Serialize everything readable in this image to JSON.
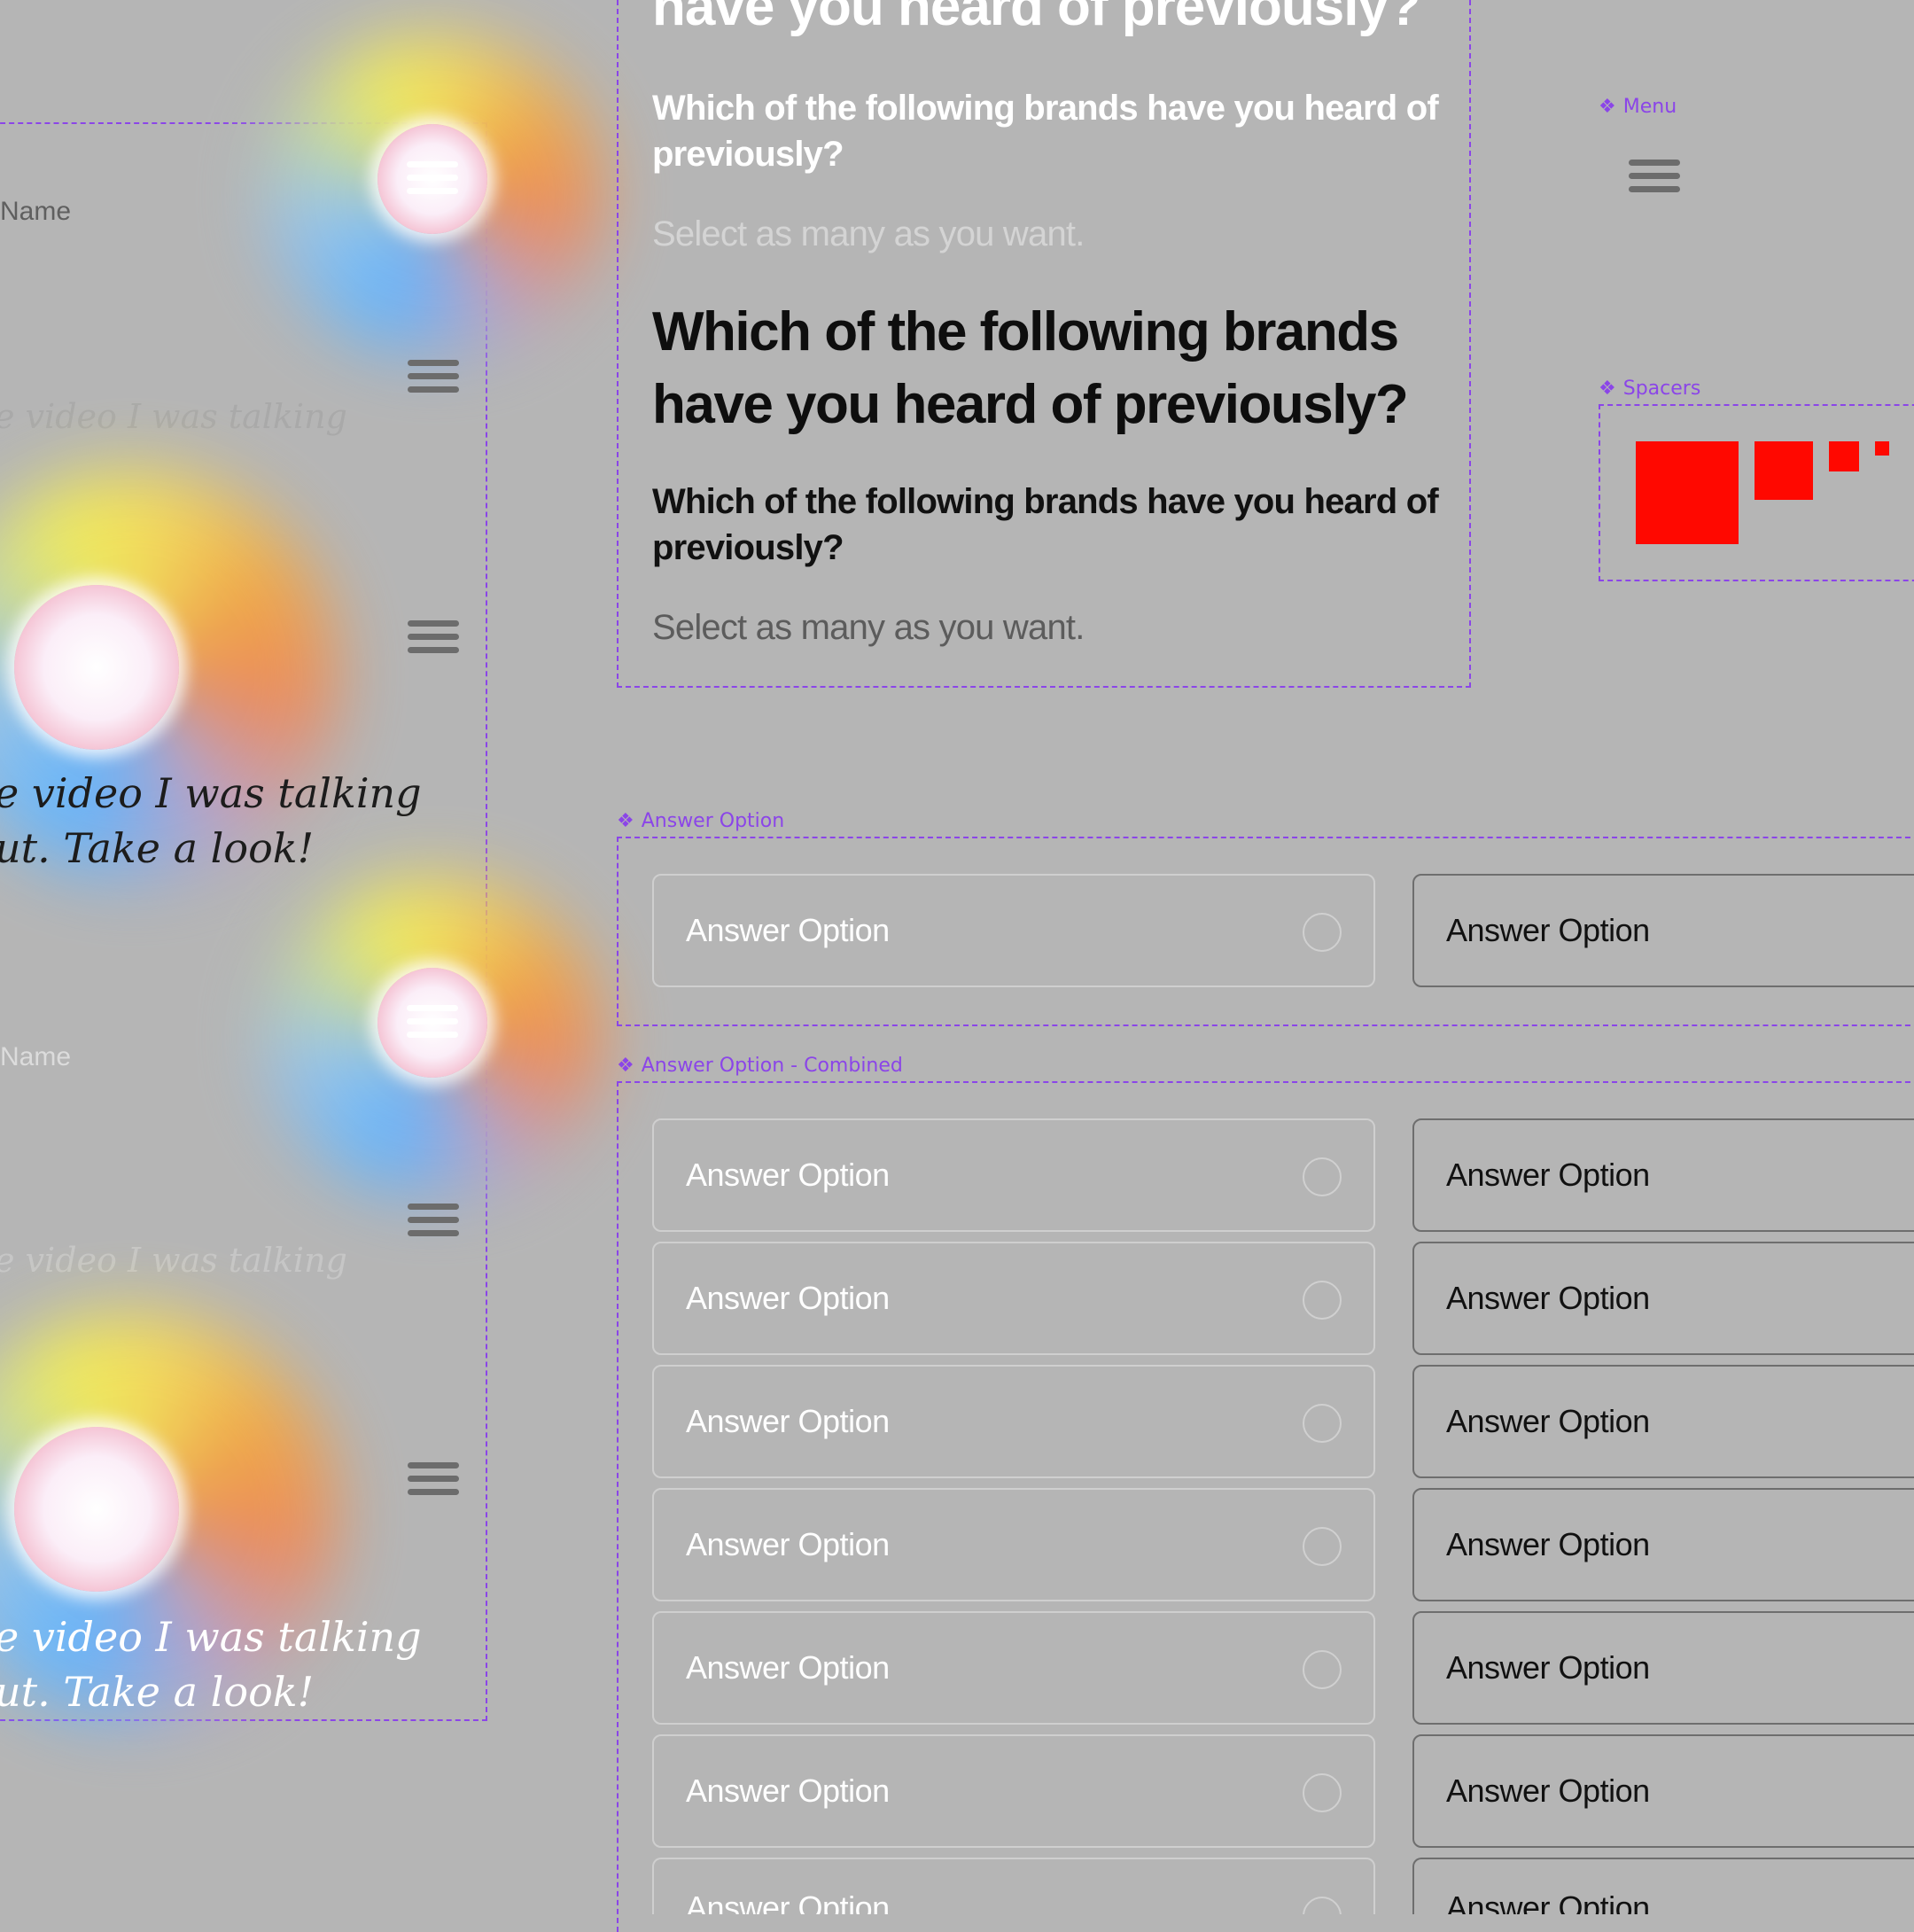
{
  "left_panel": {
    "name_label_1": "Name",
    "name_label_2": "Name",
    "faded_quote_1": "e video I was talking",
    "faded_quote_2": "e video I was talking",
    "quote_dark": {
      "line1": "e video I was talking",
      "line2": "ut. Take a look!"
    },
    "quote_light": {
      "line1": "e video I was talking",
      "line2": "ut. Take a look!"
    }
  },
  "typography_panel": {
    "top_heading": "have you heard of previously?",
    "question_light": "Which of the following brands have you heard of previously?",
    "helper_light": "Select as many as you want.",
    "question_large": "Which of the following brands have you heard of previously?",
    "question_dark": "Which of the following brands have you heard of previously?",
    "helper_dark": "Select as many as you want."
  },
  "components": {
    "menu_label": "Menu",
    "spacers_label": "Spacers",
    "answer_option_label": "Answer Option",
    "answer_option_combined_label": "Answer Option - Combined"
  },
  "answer_option_single": {
    "light": "Answer Option",
    "dark": "Answer Option"
  },
  "answer_options_combined": [
    {
      "light": "Answer Option",
      "dark": "Answer Option"
    },
    {
      "light": "Answer Option",
      "dark": "Answer Option"
    },
    {
      "light": "Answer Option",
      "dark": "Answer Option"
    },
    {
      "light": "Answer Option",
      "dark": "Answer Option"
    },
    {
      "light": "Answer Option",
      "dark": "Answer Option"
    },
    {
      "light": "Answer Option",
      "dark": "Answer Option"
    },
    {
      "light": "Answer Option",
      "dark": "Answer Option"
    }
  ],
  "colors": {
    "background": "#b5b5b5",
    "component_outline": "#8b45e8",
    "spacer_fill": "#ff0800"
  },
  "icons": [
    "hamburger-menu-icon",
    "component-diamond-icon",
    "radio-circle-icon"
  ]
}
